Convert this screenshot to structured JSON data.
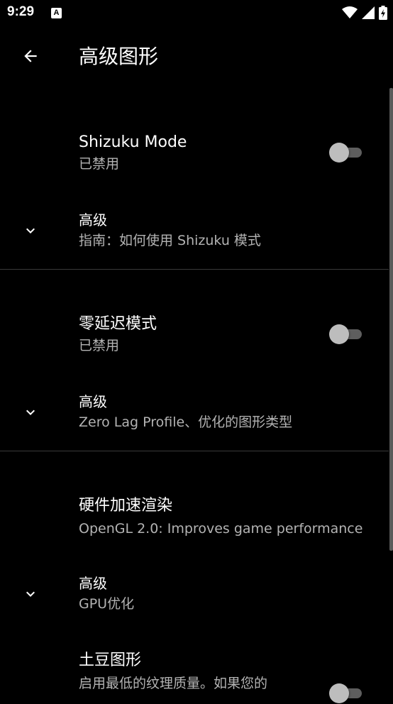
{
  "status_bar": {
    "time": "9:29",
    "notification_icon": "A"
  },
  "app_bar": {
    "title": "高级图形"
  },
  "sections": [
    {
      "toggle_pref": {
        "title": "Shizuku Mode",
        "summary": "已禁用",
        "checked": false
      },
      "advanced": {
        "title": "高级",
        "summary": "指南：如何使用 Shizuku 模式"
      }
    },
    {
      "toggle_pref": {
        "title": "零延迟模式",
        "summary": "已禁用",
        "checked": false
      },
      "advanced": {
        "title": "高级",
        "summary": "Zero Lag Profile、优化的图形类型"
      }
    },
    {
      "plain_pref": {
        "title": "硬件加速渲染",
        "summary": "OpenGL 2.0: Improves game performance"
      },
      "advanced": {
        "title": "高级",
        "summary": "GPU优化"
      },
      "toggle_pref": {
        "title": "土豆图形",
        "summary": "启用最低的纹理质量。如果您的",
        "checked": false
      }
    }
  ],
  "colors": {
    "background": "#000000",
    "text_primary": "#ffffff",
    "text_secondary": "#b3b3b3",
    "toggle_thumb_off": "#bdbdbd",
    "toggle_track_off": "#5e5e5e",
    "divider": "#3a3a3a"
  },
  "icons": {
    "back": "arrow-left-icon",
    "expand": "chevron-down-icon",
    "wifi": "wifi-icon",
    "signal": "signal-icon",
    "battery": "battery-charging-icon"
  }
}
